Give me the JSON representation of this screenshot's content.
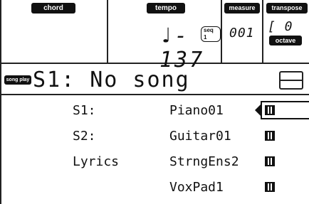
{
  "header": {
    "chord_label": "chord",
    "tempo_label": "tempo",
    "tempo_value": "♩- 137",
    "tempo_source": "seq 1",
    "measure_label": "measure",
    "measure_value": "001",
    "transpose_label": "transpose",
    "transpose_value": "[ 0",
    "octave_label": "octave"
  },
  "song": {
    "mode_tag": "song play",
    "title": "S1: No song"
  },
  "tracks": [
    {
      "left": "S1:",
      "sound": "Piano01",
      "selected": true
    },
    {
      "left": "S2:",
      "sound": "Guitar01",
      "selected": false
    },
    {
      "left": "Lyrics",
      "sound": "StrngEns2",
      "selected": false
    },
    {
      "left": "",
      "sound": "VoxPad1",
      "selected": false
    }
  ],
  "icons": {
    "keyboard": "keyboard-icon",
    "pointer": "selection-arrow-icon"
  }
}
